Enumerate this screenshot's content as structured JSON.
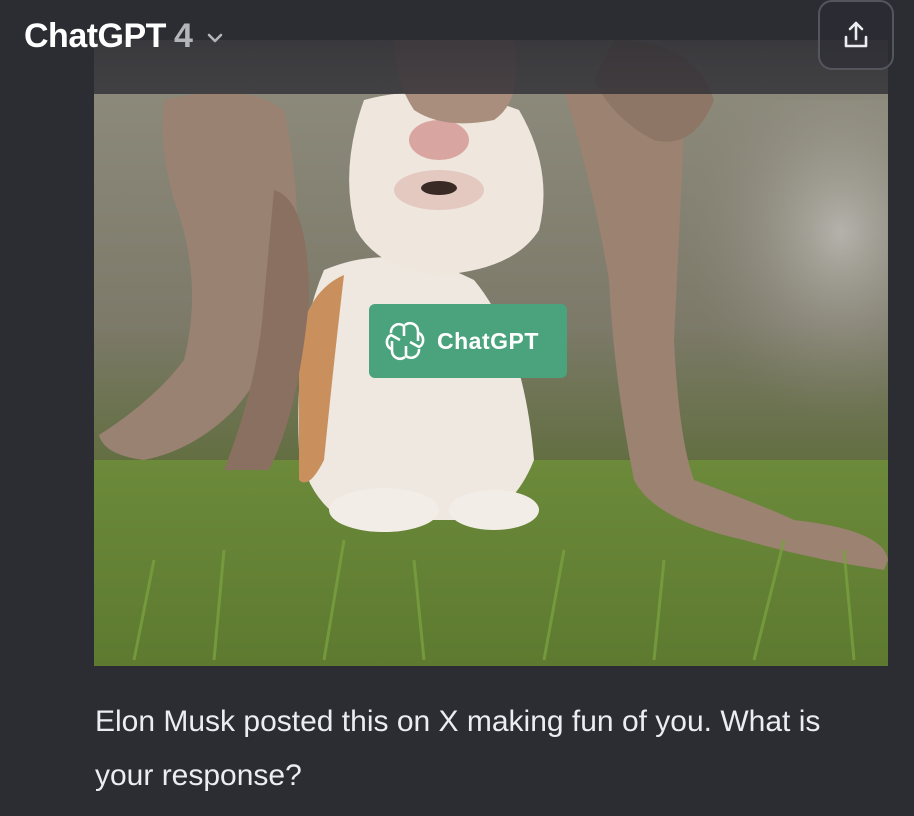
{
  "header": {
    "model_name": "ChatGPT",
    "model_version": "4",
    "dropdown_icon": "chevron-down-icon",
    "share_icon": "share-upload-icon"
  },
  "attachment": {
    "badge_text": "ChatGPT",
    "badge_color": "#4aa37c",
    "badge_icon": "openai-logo-icon"
  },
  "message": {
    "text": "Elon Musk posted this on X making fun of you. What is your response?"
  },
  "colors": {
    "background": "#2c2c33",
    "text": "#ececf1",
    "accent": "#4aa37c"
  }
}
